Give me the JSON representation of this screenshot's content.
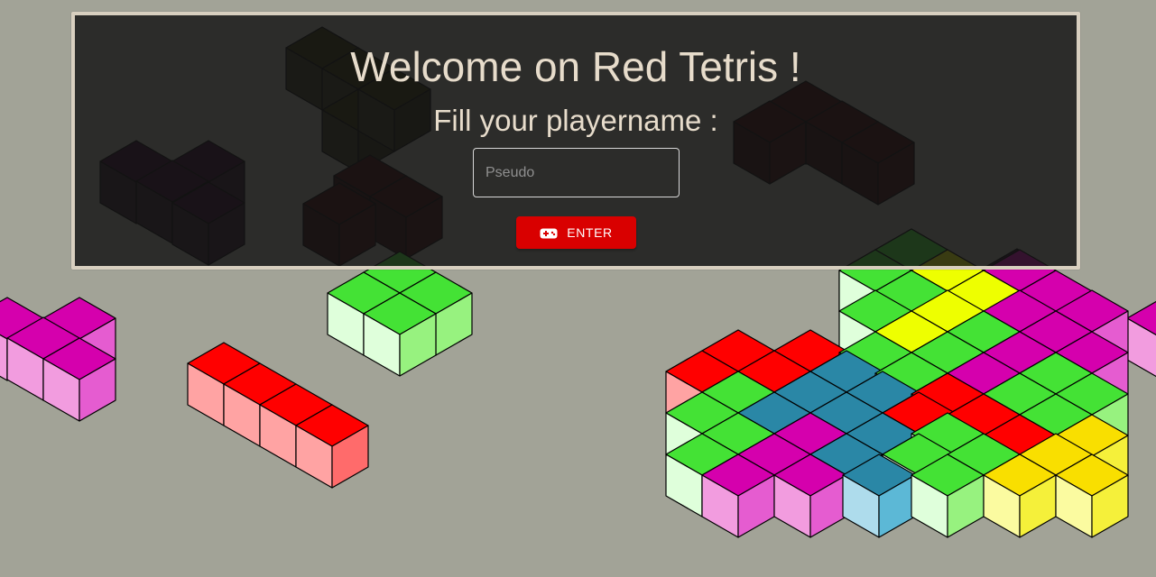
{
  "welcome": {
    "title": "Welcome on Red Tetris !",
    "subtitle": "Fill your playername :"
  },
  "form": {
    "pseudo_placeholder": "Pseudo",
    "pseudo_value": "",
    "enter_label": "ENTER",
    "enter_icon": "gamepad-icon"
  },
  "theme": {
    "background": "#a2a397",
    "panel_background": "#1e1e1e",
    "panel_border": "#d8cfbf",
    "text": "#e7dccb",
    "button": "#d90000"
  },
  "background_colors": {
    "red": [
      "#ff0000",
      "#ffa3a3",
      "#ff6b6b"
    ],
    "green": [
      "#44e235",
      "#dfffdb",
      "#97f27f"
    ],
    "magenta": [
      "#d500ad",
      "#f29cdf",
      "#e55cd0"
    ],
    "yellow": [
      "#eeff00",
      "#f9fba0",
      "#f5f03a"
    ],
    "gold": [
      "#f9df00",
      "#fbfba0",
      "#f5f03a"
    ],
    "teal": [
      "#2a87a6",
      "#aedcec",
      "#5cb8d6"
    ]
  }
}
